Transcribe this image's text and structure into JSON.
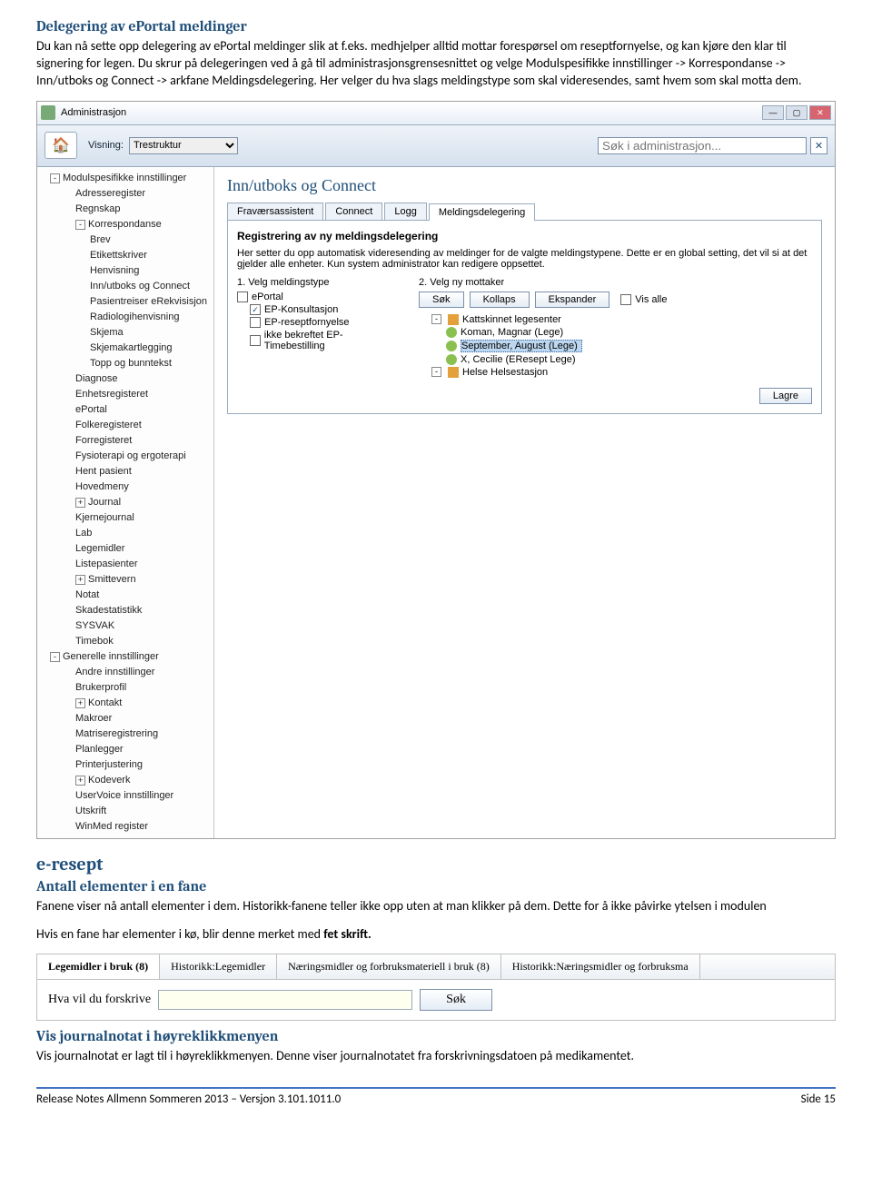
{
  "h1": "Delegering av ePortal meldinger",
  "p1": "Du kan nå sette opp delegering av ePortal meldinger slik at f.eks. medhjelper alltid mottar forespørsel om reseptfornyelse, og kan kjøre den klar til signering for legen. Du skrur på delegeringen ved å gå til administrasjonsgrensesnittet og velge Modulspesifikke innstillinger -> Korrespondanse -> Inn/utboks og Connect -> arkfane Meldingsdelegering. Her velger du hva slags meldingstype som skal videresendes, samt hvem som skal motta dem.",
  "admin": {
    "title": "Administrasjon",
    "visning": "Visning:",
    "visning_val": "Trestruktur",
    "search_ph": "Søk i administrasjon...",
    "tree": [
      {
        "lvl": 0,
        "exp": "-",
        "t": "Modulspesifikke innstillinger"
      },
      {
        "lvl": 1,
        "exp": "",
        "t": "Adresseregister"
      },
      {
        "lvl": 1,
        "exp": "",
        "t": "Regnskap"
      },
      {
        "lvl": 1,
        "exp": "-",
        "t": "Korrespondanse"
      },
      {
        "lvl": 2,
        "exp": "",
        "t": "Brev"
      },
      {
        "lvl": 2,
        "exp": "",
        "t": "Etikettskriver"
      },
      {
        "lvl": 2,
        "exp": "",
        "t": "Henvisning"
      },
      {
        "lvl": 2,
        "exp": "",
        "t": "Inn/utboks og Connect"
      },
      {
        "lvl": 2,
        "exp": "",
        "t": "Pasientreiser eRekvisisjon"
      },
      {
        "lvl": 2,
        "exp": "",
        "t": "Radiologihenvisning"
      },
      {
        "lvl": 2,
        "exp": "",
        "t": "Skjema"
      },
      {
        "lvl": 2,
        "exp": "",
        "t": "Skjemakartlegging"
      },
      {
        "lvl": 2,
        "exp": "",
        "t": "Topp og bunntekst"
      },
      {
        "lvl": 1,
        "exp": "",
        "t": "Diagnose"
      },
      {
        "lvl": 1,
        "exp": "",
        "t": "Enhetsregisteret"
      },
      {
        "lvl": 1,
        "exp": "",
        "t": "ePortal"
      },
      {
        "lvl": 1,
        "exp": "",
        "t": "Folkeregisteret"
      },
      {
        "lvl": 1,
        "exp": "",
        "t": "Forregisteret"
      },
      {
        "lvl": 1,
        "exp": "",
        "t": "Fysioterapi og ergoterapi"
      },
      {
        "lvl": 1,
        "exp": "",
        "t": "Hent pasient"
      },
      {
        "lvl": 1,
        "exp": "",
        "t": "Hovedmeny"
      },
      {
        "lvl": 1,
        "exp": "+",
        "t": "Journal"
      },
      {
        "lvl": 1,
        "exp": "",
        "t": "Kjernejournal"
      },
      {
        "lvl": 1,
        "exp": "",
        "t": "Lab"
      },
      {
        "lvl": 1,
        "exp": "",
        "t": "Legemidler"
      },
      {
        "lvl": 1,
        "exp": "",
        "t": "Listepasienter"
      },
      {
        "lvl": 1,
        "exp": "+",
        "t": "Smittevern"
      },
      {
        "lvl": 1,
        "exp": "",
        "t": "Notat"
      },
      {
        "lvl": 1,
        "exp": "",
        "t": "Skadestatistikk"
      },
      {
        "lvl": 1,
        "exp": "",
        "t": "SYSVAK"
      },
      {
        "lvl": 1,
        "exp": "",
        "t": "Timebok"
      },
      {
        "lvl": 0,
        "exp": "-",
        "t": "Generelle innstillinger"
      },
      {
        "lvl": 1,
        "exp": "",
        "t": "Andre innstillinger"
      },
      {
        "lvl": 1,
        "exp": "",
        "t": "Brukerprofil"
      },
      {
        "lvl": 1,
        "exp": "+",
        "t": "Kontakt"
      },
      {
        "lvl": 1,
        "exp": "",
        "t": "Makroer"
      },
      {
        "lvl": 1,
        "exp": "",
        "t": "Matriseregistrering"
      },
      {
        "lvl": 1,
        "exp": "",
        "t": "Planlegger"
      },
      {
        "lvl": 1,
        "exp": "",
        "t": "Printerjustering"
      },
      {
        "lvl": 1,
        "exp": "+",
        "t": "Kodeverk"
      },
      {
        "lvl": 1,
        "exp": "",
        "t": "UserVoice innstillinger"
      },
      {
        "lvl": 1,
        "exp": "",
        "t": "Utskrift"
      },
      {
        "lvl": 1,
        "exp": "",
        "t": "WinMed register"
      }
    ],
    "content_title": "Inn/utboks og Connect",
    "tabs": [
      "Fraværsassistent",
      "Connect",
      "Logg",
      "Meldingsdelegering"
    ],
    "active_tab": 3,
    "panel_title": "Registrering av ny meldingsdelegering",
    "panel_desc": "Her setter du opp automatisk videresending av meldinger for de valgte meldingstypene. Dette er en global setting, det vil si at det gjelder alle enheter. Kun system administrator kan redigere oppsettet.",
    "step1": "1. Velg meldingstype",
    "step2": "2. Velg ny mottaker",
    "types": [
      {
        "c": false,
        "t": "ePortal"
      },
      {
        "c": true,
        "t": "EP-Konsultasjon"
      },
      {
        "c": false,
        "t": "EP-reseptfornyelse"
      },
      {
        "c": false,
        "t": "ikke bekreftet EP-Timebestilling"
      }
    ],
    "btn_search": "Søk",
    "btn_collapse": "Kollaps",
    "btn_expand": "Ekspander",
    "chk_all": "Vis alle",
    "users": [
      {
        "lvl": 0,
        "ic": "house",
        "t": "Kattskinnet legesenter"
      },
      {
        "lvl": 1,
        "ic": "user",
        "t": "Koman, Magnar (Lege)"
      },
      {
        "lvl": 1,
        "ic": "user",
        "t": "September, August (Lege)",
        "sel": true
      },
      {
        "lvl": 1,
        "ic": "user",
        "t": "X, Cecilie (EResept Lege)"
      },
      {
        "lvl": 0,
        "ic": "house",
        "t": "Helse Helsestasjon"
      }
    ],
    "lagre": "Lagre"
  },
  "h2": "e-resept",
  "h3": "Antall elementer i en fane",
  "p2": "Fanene viser nå antall elementer i dem. Historikk-fanene teller ikke opp uten at man klikker på dem. Dette for å ikke påvirke ytelsen i modulen",
  "p3a": "Hvis en fane har elementer i kø, blir denne merket med ",
  "p3b": "fet skrift.",
  "tabs2": [
    {
      "t": "Legemidler i bruk (8)",
      "bold": true
    },
    {
      "t": "Historikk:Legemidler",
      "bold": false
    },
    {
      "t": "Næringsmidler og forbruksmateriell i bruk (8)",
      "bold": false
    },
    {
      "t": "Historikk:Næringsmidler og forbruksma",
      "bold": false
    }
  ],
  "row2_label": "Hva vil du forskrive",
  "row2_btn": "Søk",
  "h4": "Vis journalnotat i høyreklikkmenyen",
  "p4": "Vis journalnotat er lagt til i høyreklikkmenyen. Denne viser journalnotatet fra forskrivningsdatoen på medikamentet.",
  "footer_l": "Release Notes Allmenn Sommeren 2013 – Versjon 3.101.1011.0",
  "footer_r": "Side 15"
}
